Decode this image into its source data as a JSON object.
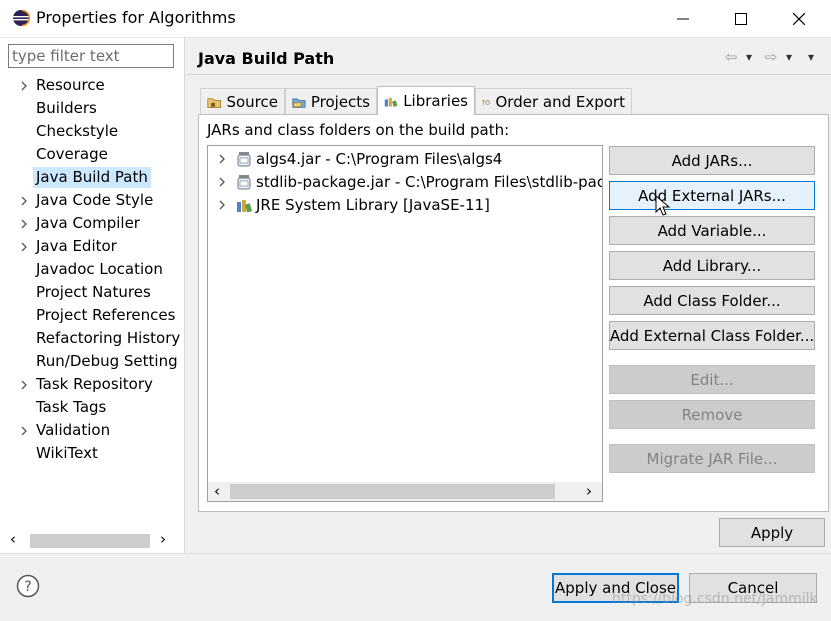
{
  "window": {
    "title": "Properties for Algorithms",
    "minimize_glyph": "—",
    "maximize_glyph": "☐",
    "close_glyph": "✕"
  },
  "sidebar": {
    "filter_placeholder": "type filter text",
    "items": [
      {
        "label": "Resource",
        "expandable": true
      },
      {
        "label": "Builders",
        "expandable": false
      },
      {
        "label": "Checkstyle",
        "expandable": false
      },
      {
        "label": "Coverage",
        "expandable": false
      },
      {
        "label": "Java Build Path",
        "expandable": false,
        "selected": true
      },
      {
        "label": "Java Code Style",
        "expandable": true
      },
      {
        "label": "Java Compiler",
        "expandable": true
      },
      {
        "label": "Java Editor",
        "expandable": true
      },
      {
        "label": "Javadoc Location",
        "expandable": false
      },
      {
        "label": "Project Natures",
        "expandable": false
      },
      {
        "label": "Project References",
        "expandable": false
      },
      {
        "label": "Refactoring History",
        "expandable": false
      },
      {
        "label": "Run/Debug Setting",
        "expandable": false
      },
      {
        "label": "Task Repository",
        "expandable": true
      },
      {
        "label": "Task Tags",
        "expandable": false
      },
      {
        "label": "Validation",
        "expandable": true
      },
      {
        "label": "WikiText",
        "expandable": false
      }
    ]
  },
  "page": {
    "title": "Java Build Path",
    "nav": {
      "back": "⇦",
      "forward": "⇨",
      "dropdown": "▾"
    }
  },
  "tabs": [
    {
      "label": "Source",
      "icon": "source-folder-icon",
      "active": false
    },
    {
      "label": "Projects",
      "icon": "projects-icon",
      "active": false
    },
    {
      "label": "Libraries",
      "icon": "libraries-icon",
      "active": true
    },
    {
      "label": "Order and Export",
      "icon": "order-export-icon",
      "active": false
    }
  ],
  "libraries": {
    "caption": "JARs and class folders on the build path:",
    "entries": [
      {
        "label": "algs4.jar - C:\\Program Files\\algs4",
        "icon": "jar-icon"
      },
      {
        "label": "stdlib-package.jar - C:\\Program Files\\stdlib-pack",
        "icon": "jar-icon"
      },
      {
        "label": "JRE System Library [JavaSE-11]",
        "icon": "library-icon"
      }
    ]
  },
  "buttons": {
    "add_jars": "Add JARs...",
    "add_external_jars": "Add External JARs...",
    "add_variable": "Add Variable...",
    "add_library": "Add Library...",
    "add_class_folder": "Add Class Folder...",
    "add_external_class_folder": "Add External Class Folder...",
    "edit": "Edit...",
    "remove": "Remove",
    "migrate_jar": "Migrate JAR File...",
    "apply": "Apply",
    "apply_and_close": "Apply and Close",
    "cancel": "Cancel"
  },
  "scroll": {
    "left": "‹",
    "right": "›"
  },
  "help": {
    "glyph": "?"
  },
  "watermark": "https://blog.csdn.net/Jammilk",
  "colors": {
    "accent": "#0078d7",
    "selection": "#cce8ff",
    "disabled_button": "#cccccc"
  }
}
